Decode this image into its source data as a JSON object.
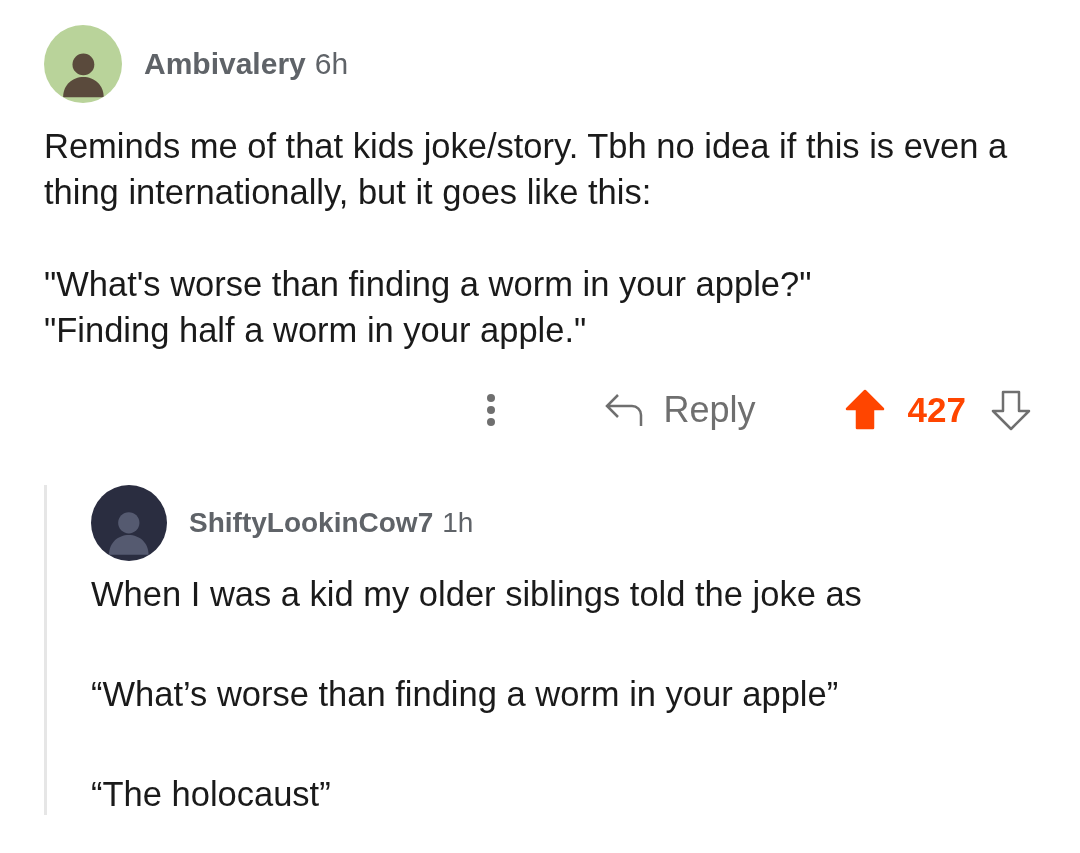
{
  "comment": {
    "author": "Ambivalery",
    "age": "6h",
    "paragraphs": [
      "Reminds me of that kids joke/story. Tbh no idea if this is even a thing internationally, but it goes like this:",
      "\"What's worse than finding a worm in your apple?\"\n\"Finding half a worm in your apple.\""
    ],
    "actions": {
      "reply_label": "Reply",
      "score": "427",
      "upvoted": true,
      "downvoted": false
    },
    "reply": {
      "author": "ShiftyLookinCow7",
      "age": "1h",
      "paragraphs": [
        "When I was a kid my older siblings told the joke as",
        "“What’s worse than finding a worm in your apple”",
        "“The holocaust”"
      ]
    }
  }
}
